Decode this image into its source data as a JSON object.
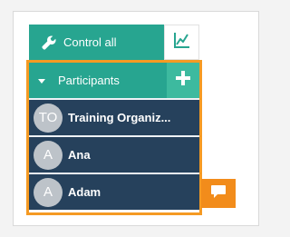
{
  "controls": {
    "control_all_label": "Control all",
    "control_icon": "wrench-icon",
    "stats_icon": "line-chart-icon"
  },
  "participants": {
    "header_label": "Participants",
    "add_icon": "plus-icon",
    "list": [
      {
        "initials": "TO",
        "name": "Training Organiz..."
      },
      {
        "initials": "A",
        "name": "Ana"
      },
      {
        "initials": "A",
        "name": "Adam"
      }
    ]
  },
  "chat": {
    "icon": "chat-bubble-icon"
  },
  "colors": {
    "accent_green": "#27a590",
    "header_green_light": "#3dba9f",
    "participant_bg": "#26415c",
    "highlight_orange": "#f59a23",
    "chat_orange": "#f28c1b"
  }
}
